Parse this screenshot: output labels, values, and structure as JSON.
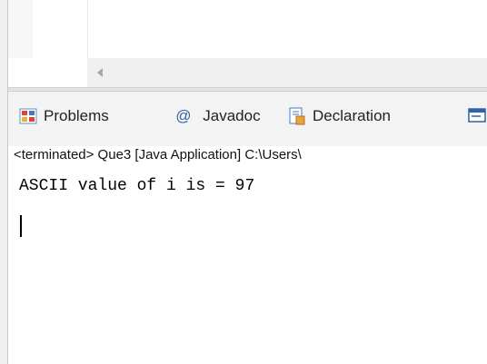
{
  "tabs": [
    {
      "label": "Problems",
      "icon": "problems-icon"
    },
    {
      "label": "Javadoc",
      "icon": "at-icon",
      "glyph": "@"
    },
    {
      "label": "Declaration",
      "icon": "declaration-icon"
    }
  ],
  "status": "<terminated> Que3 [Java Application] C:\\Users\\",
  "console": {
    "lines": [
      "ASCII value of i is = 97"
    ]
  },
  "colors": {
    "tab_bar_bg": "#f3f3f3",
    "panel_border": "#c8c8c8",
    "javadoc_icon": "#2c64a8"
  }
}
